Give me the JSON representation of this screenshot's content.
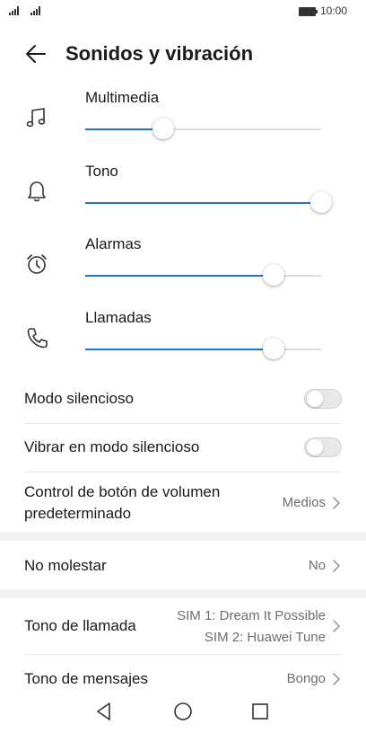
{
  "status_bar": {
    "time": "10:00",
    "icons": [
      "signal-icon",
      "signal-icon",
      "battery-icon"
    ]
  },
  "header": {
    "title": "Sonidos y vibración",
    "back_icon": "arrow-left-icon"
  },
  "volume": {
    "accent_color": "#1a74d8",
    "items": [
      {
        "label": "Multimedia",
        "icon": "music-note-icon",
        "level": 0.33
      },
      {
        "label": "Tono",
        "icon": "bell-icon",
        "level": 1.0
      },
      {
        "label": "Alarmas",
        "icon": "alarm-clock-icon",
        "level": 0.8
      },
      {
        "label": "Llamadas",
        "icon": "phone-icon",
        "level": 0.8
      }
    ]
  },
  "settings": {
    "silent_mode": {
      "label": "Modo silencioso",
      "enabled": false
    },
    "vibrate_silent": {
      "label": "Vibrar en modo silencioso",
      "enabled": false
    },
    "volume_button": {
      "label_line1": "Control de botón de volumen",
      "label_line2": "predeterminado",
      "value": "Medios"
    },
    "do_not_disturb": {
      "label": "No molestar",
      "value": "No"
    },
    "ringtone": {
      "label": "Tono de llamada",
      "value_line1": "SIM 1: Dream It Possible",
      "value_line2": "SIM 2: Huawei Tune"
    },
    "message_tone": {
      "label": "Tono de mensajes",
      "value": "Bongo"
    }
  },
  "nav_bar": {
    "icons": [
      "back-triangle-icon",
      "home-circle-icon",
      "recents-square-icon"
    ]
  }
}
